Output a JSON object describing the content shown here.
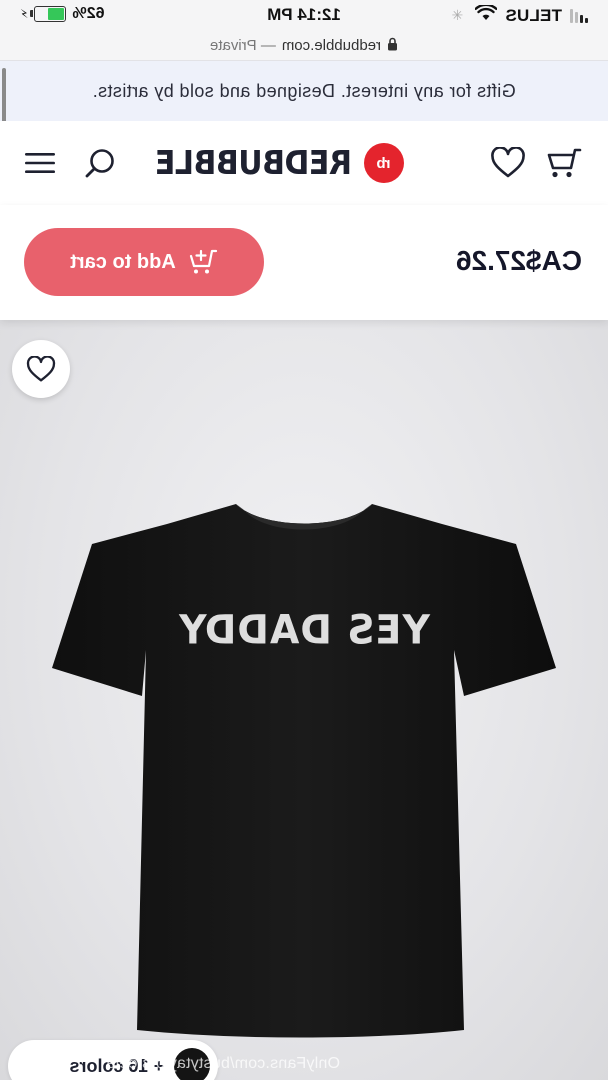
{
  "status_bar": {
    "carrier": "TELUS",
    "time": "12:14 PM",
    "battery_percent": "62%",
    "battery_level": 0.62,
    "icons": [
      "signal-icon",
      "wifi-icon",
      "loading-spinner-icon",
      "battery-icon",
      "charging-bolt-icon"
    ]
  },
  "browser": {
    "url": "redbubble.com",
    "mode": "— Private"
  },
  "promo": {
    "text": "Gifts for any interest. Designed and sold by artists."
  },
  "nav": {
    "logo_text": "REDBUBBLE",
    "logo_badge": "rb",
    "icons": [
      "menu-icon",
      "search-icon",
      "heart-icon",
      "cart-icon"
    ]
  },
  "buy_bar": {
    "price": "CA$27.26",
    "add_to_cart_label": "Add to cart",
    "button_color": "#e8616c"
  },
  "product": {
    "print_text": "YES DADDY",
    "shirt_color": "#141414",
    "colors_label": "+ 16 colors",
    "watermark": "OnlyFans.com/bustytaylorsteele"
  },
  "colors": {
    "brand_red": "#e4242d",
    "ink": "#1e2130"
  }
}
